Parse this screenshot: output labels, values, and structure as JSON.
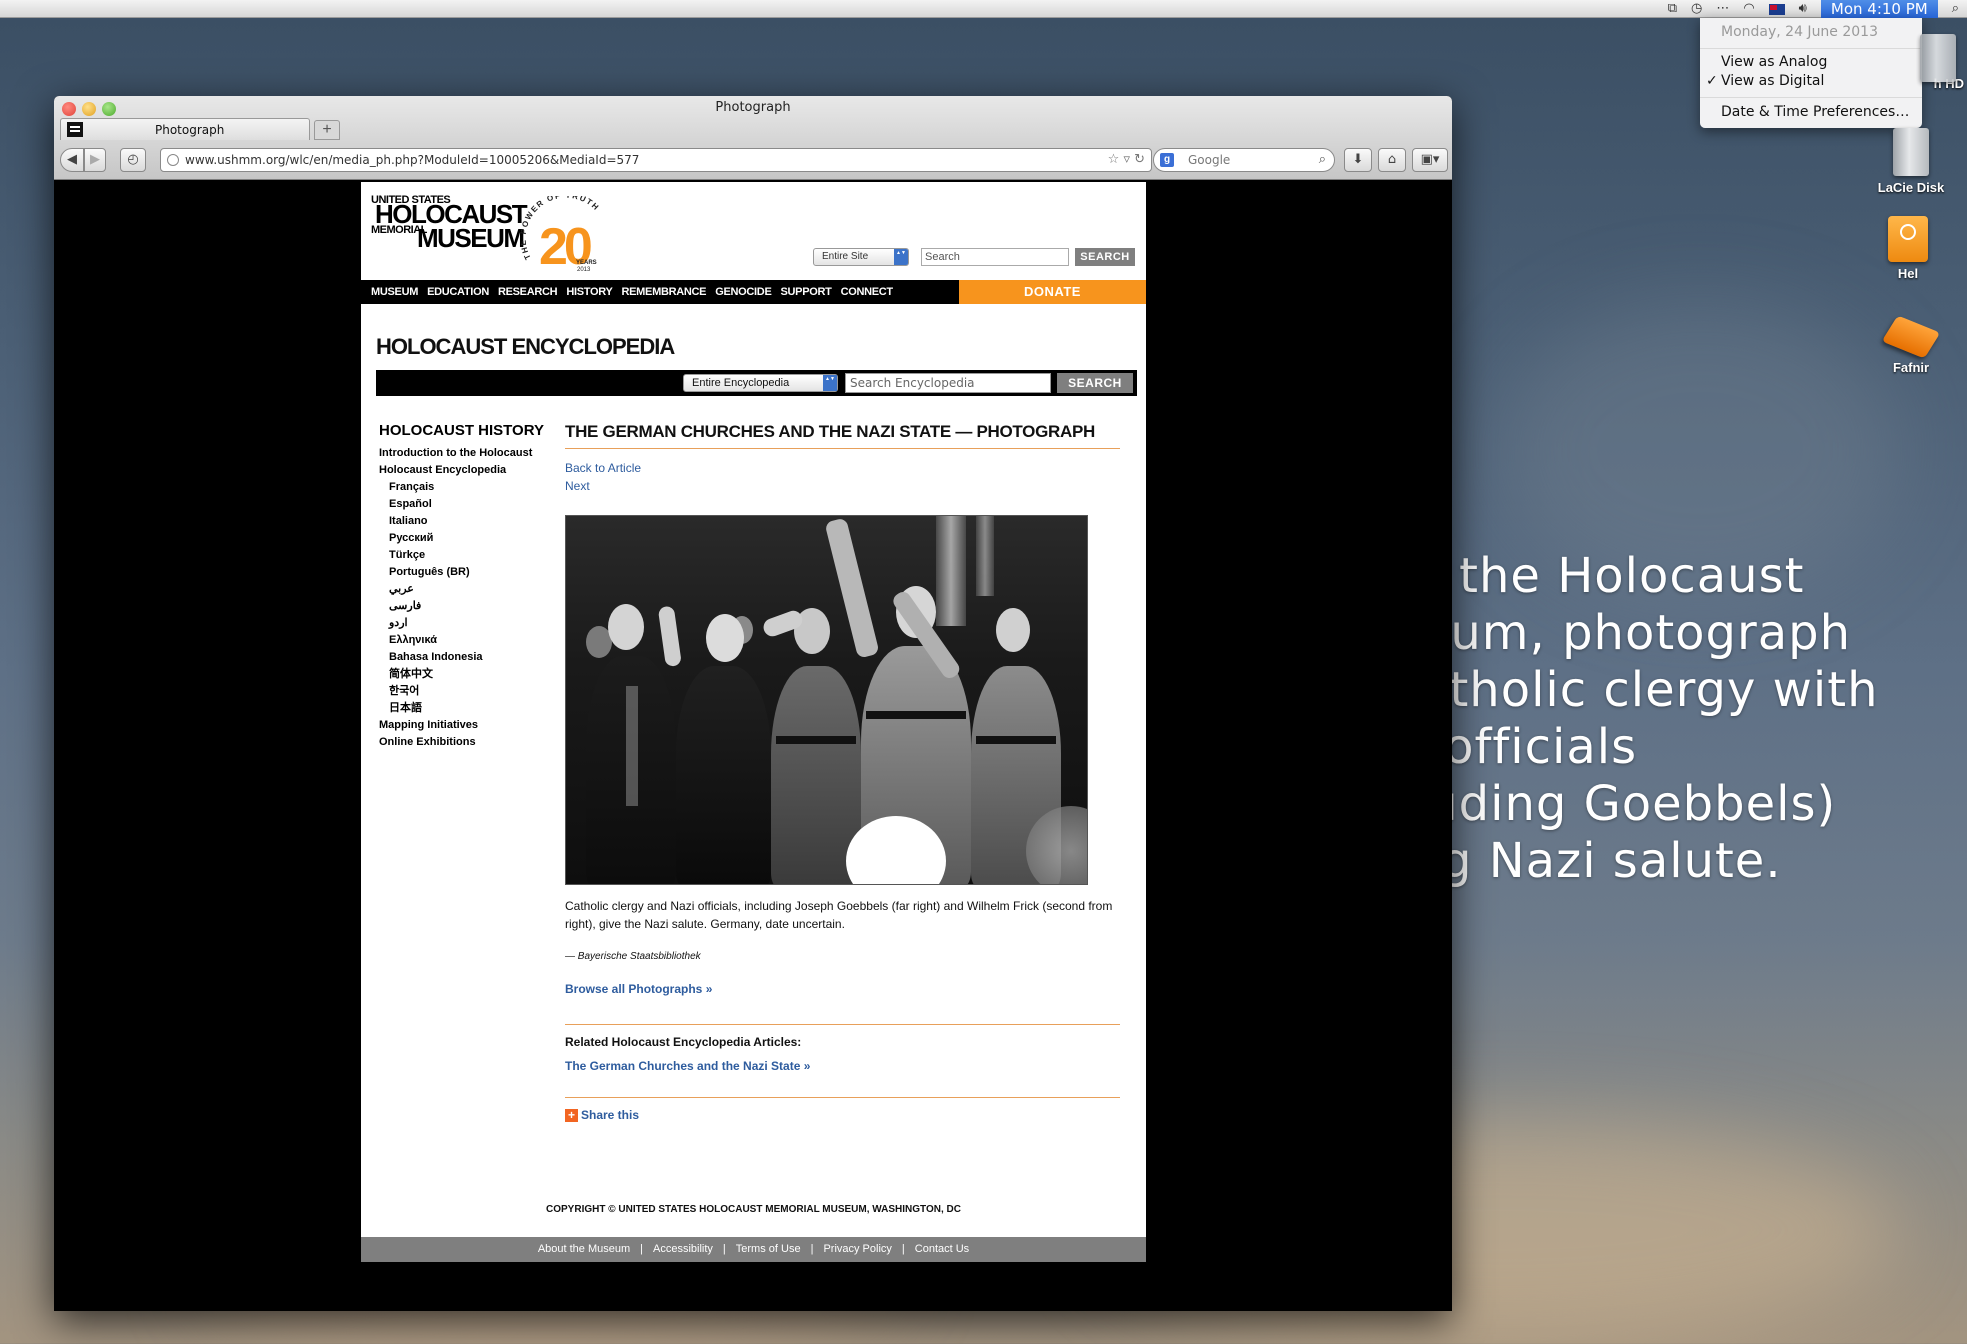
{
  "menubar": {
    "clock": "Mon 4:10 PM"
  },
  "clock_menu": {
    "date": "Monday, 24 June 2013",
    "item_analog": "View as Analog",
    "item_digital": "View as Digital",
    "check": "✓",
    "item_prefs": "Date & Time Preferences…"
  },
  "desktop": {
    "icons": [
      {
        "label": "h HD"
      },
      {
        "label": "LaCie Disk"
      },
      {
        "label": "Hel"
      },
      {
        "label": "Fafnir"
      }
    ],
    "caption": "From the Holocaust Museum, photograph of Catholic clergy with Nazi officials (including Goebbels) giving Nazi salute."
  },
  "browser": {
    "window_title": "Photograph",
    "tab_label": "Photograph",
    "new_tab": "+",
    "url": "www.ushmm.org/wlc/en/media_ph.php?ModuleId=10005206&MediaId=577",
    "search_placeholder": "Google"
  },
  "site": {
    "logo_line1": "UNITED STATES",
    "logo_line2": "HOLOCAUST",
    "logo_line3": "MEMORIAL",
    "logo_line4": "MUSEUM",
    "anniv_arc": "THE POWER OF TRUTH",
    "anniv_number": "20",
    "anniv_years": "YEARS",
    "anniv_year": "2013",
    "scope_select": "Entire Site",
    "search_placeholder": "Search",
    "search_button": "SEARCH",
    "nav": [
      "MUSEUM",
      "EDUCATION",
      "RESEARCH",
      "HISTORY",
      "REMEMBRANCE",
      "GENOCIDE",
      "SUPPORT",
      "CONNECT"
    ],
    "donate": "DONATE"
  },
  "encyclopedia": {
    "title": "HOLOCAUST ENCYCLOPEDIA",
    "scope_select": "Entire Encyclopedia",
    "search_placeholder": "Search Encyclopedia",
    "search_button": "SEARCH"
  },
  "sidebar": {
    "title": "HOLOCAUST HISTORY",
    "items": [
      {
        "label": "Introduction to the Holocaust",
        "sub": false
      },
      {
        "label": "Holocaust Encyclopedia",
        "sub": false
      },
      {
        "label": "Français",
        "sub": true
      },
      {
        "label": "Español",
        "sub": true
      },
      {
        "label": "Italiano",
        "sub": true
      },
      {
        "label": "Русский",
        "sub": true
      },
      {
        "label": "Türkçe",
        "sub": true
      },
      {
        "label": "Português (BR)",
        "sub": true
      },
      {
        "label": "عربي",
        "sub": true
      },
      {
        "label": "فارسی",
        "sub": true
      },
      {
        "label": "اردو",
        "sub": true
      },
      {
        "label": "Ελληνικά",
        "sub": true
      },
      {
        "label": "Bahasa Indonesia",
        "sub": true
      },
      {
        "label": "简体中文",
        "sub": true
      },
      {
        "label": "한국어",
        "sub": true
      },
      {
        "label": "日本語",
        "sub": true
      },
      {
        "label": "Mapping Initiatives",
        "sub": false
      },
      {
        "label": "Online Exhibitions",
        "sub": false
      }
    ]
  },
  "article": {
    "title": "THE GERMAN CHURCHES AND THE NAZI STATE — PHOTOGRAPH",
    "back_link": "Back to Article",
    "next_link": "Next",
    "caption": "Catholic clergy and Nazi officials, including Joseph Goebbels (far right) and Wilhelm Frick (second from right), give the Nazi salute. Germany, date uncertain.",
    "credit": "— Bayerische Staatsbibliothek",
    "browse_link": "Browse all Photographs »",
    "related_title": "Related Holocaust Encyclopedia Articles:",
    "related_link": "The German Churches and the Nazi State »",
    "share_icon": "+",
    "share_label": "Share this"
  },
  "footer": {
    "copyright": "COPYRIGHT © UNITED STATES HOLOCAUST MEMORIAL MUSEUM, WASHINGTON, DC",
    "links": [
      "About the Museum",
      "Accessibility",
      "Terms of Use",
      "Privacy Policy",
      "Contact Us"
    ]
  }
}
